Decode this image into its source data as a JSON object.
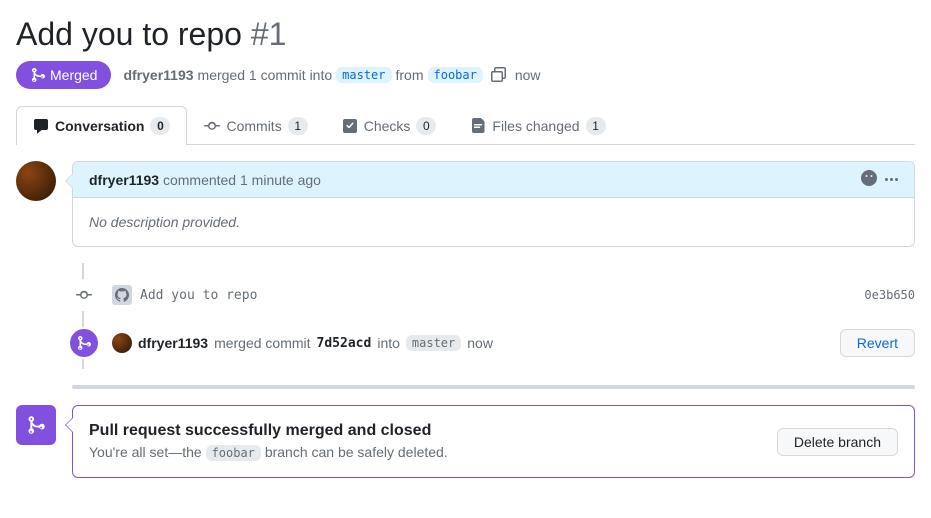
{
  "pr": {
    "title": "Add you to repo",
    "number": "#1",
    "state_label": "Merged",
    "author": "dfryer1193",
    "merged_verb": "merged 1 commit into",
    "base_branch": "master",
    "from_word": "from",
    "head_branch": "foobar",
    "time": "now"
  },
  "tabs": {
    "conversation": {
      "label": "Conversation",
      "count": "0"
    },
    "commits": {
      "label": "Commits",
      "count": "1"
    },
    "checks": {
      "label": "Checks",
      "count": "0"
    },
    "files": {
      "label": "Files changed",
      "count": "1"
    }
  },
  "comment": {
    "author": "dfryer1193",
    "verb": "commented",
    "time": "1 minute ago",
    "body": "No description provided."
  },
  "commit": {
    "message": "Add you to repo",
    "sha": "0e3b650"
  },
  "merge_event": {
    "author": "dfryer1193",
    "verb": "merged commit",
    "sha": "7d52acd",
    "into_word": "into",
    "target_branch": "master",
    "time": "now",
    "revert_label": "Revert"
  },
  "closed": {
    "title": "Pull request successfully merged and closed",
    "subtitle_prefix": "You're all set—the",
    "branch": "foobar",
    "subtitle_suffix": "branch can be safely deleted.",
    "delete_label": "Delete branch"
  }
}
